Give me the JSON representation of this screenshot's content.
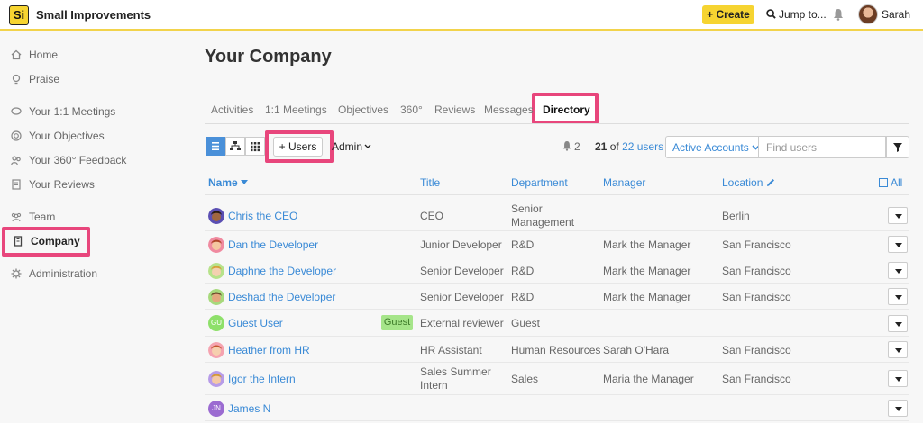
{
  "header": {
    "logo_text": "Si",
    "app_name": "Small Improvements",
    "create_label": "+ Create",
    "jump_label": "Jump to...",
    "user_name": "Sarah"
  },
  "sidebar": {
    "items": [
      {
        "label": "Home",
        "icon": "home-icon"
      },
      {
        "label": "Praise",
        "icon": "lightbulb-icon"
      },
      {
        "label": "Your 1:1 Meetings",
        "icon": "chat-icon"
      },
      {
        "label": "Your Objectives",
        "icon": "target-icon"
      },
      {
        "label": "Your 360° Feedback",
        "icon": "people-icon"
      },
      {
        "label": "Your Reviews",
        "icon": "document-icon"
      },
      {
        "label": "Team",
        "icon": "team-icon"
      },
      {
        "label": "Company",
        "icon": "building-icon"
      },
      {
        "label": "Administration",
        "icon": "gear-icon"
      }
    ]
  },
  "main": {
    "title": "Your Company",
    "tabs": [
      "Activities",
      "1:1 Meetings",
      "Objectives",
      "360°",
      "Reviews",
      "Messages",
      "Directory"
    ],
    "users_button": "+ Users",
    "admin_label": "Admin",
    "notif_count": "2",
    "count_shown": "21",
    "count_of": "of",
    "count_total": "22 users",
    "active_accounts": "Active Accounts",
    "find_placeholder": "Find users"
  },
  "table": {
    "headers": {
      "name": "Name",
      "title": "Title",
      "department": "Department",
      "manager": "Manager",
      "location": "Location",
      "all": "All"
    },
    "rows": [
      {
        "name": "Chris the CEO",
        "title": "CEO",
        "dept": "Senior Management",
        "manager": "",
        "location": "Berlin",
        "guest": ""
      },
      {
        "name": "Dan the Developer",
        "title": "Junior Developer",
        "dept": "R&D",
        "manager": "Mark the Manager",
        "location": "San Francisco",
        "guest": ""
      },
      {
        "name": "Daphne the Developer",
        "title": "Senior Developer",
        "dept": "R&D",
        "manager": "Mark the Manager",
        "location": "San Francisco",
        "guest": ""
      },
      {
        "name": "Deshad the Developer",
        "title": "Senior Developer",
        "dept": "R&D",
        "manager": "Mark the Manager",
        "location": "San Francisco",
        "guest": ""
      },
      {
        "name": "Guest User",
        "initials": "GU",
        "title": "External reviewer",
        "dept": "Guest",
        "manager": "",
        "location": "",
        "guest": "Guest"
      },
      {
        "name": "Heather from HR",
        "title": "HR Assistant",
        "dept": "Human Resources",
        "manager": "Sarah O'Hara",
        "location": "San Francisco",
        "guest": ""
      },
      {
        "name": "Igor the Intern",
        "title": "Sales Summer Intern",
        "dept": "Sales",
        "manager": "Maria the Manager",
        "location": "San Francisco",
        "guest": ""
      },
      {
        "name": "James N",
        "initials": "JN",
        "title": "",
        "dept": "",
        "manager": "",
        "location": "",
        "guest": ""
      }
    ]
  },
  "colors": {
    "accent": "#f6d431",
    "link": "#3a8ad6",
    "highlight": "#e8467c",
    "guest": "#a6e58a"
  }
}
